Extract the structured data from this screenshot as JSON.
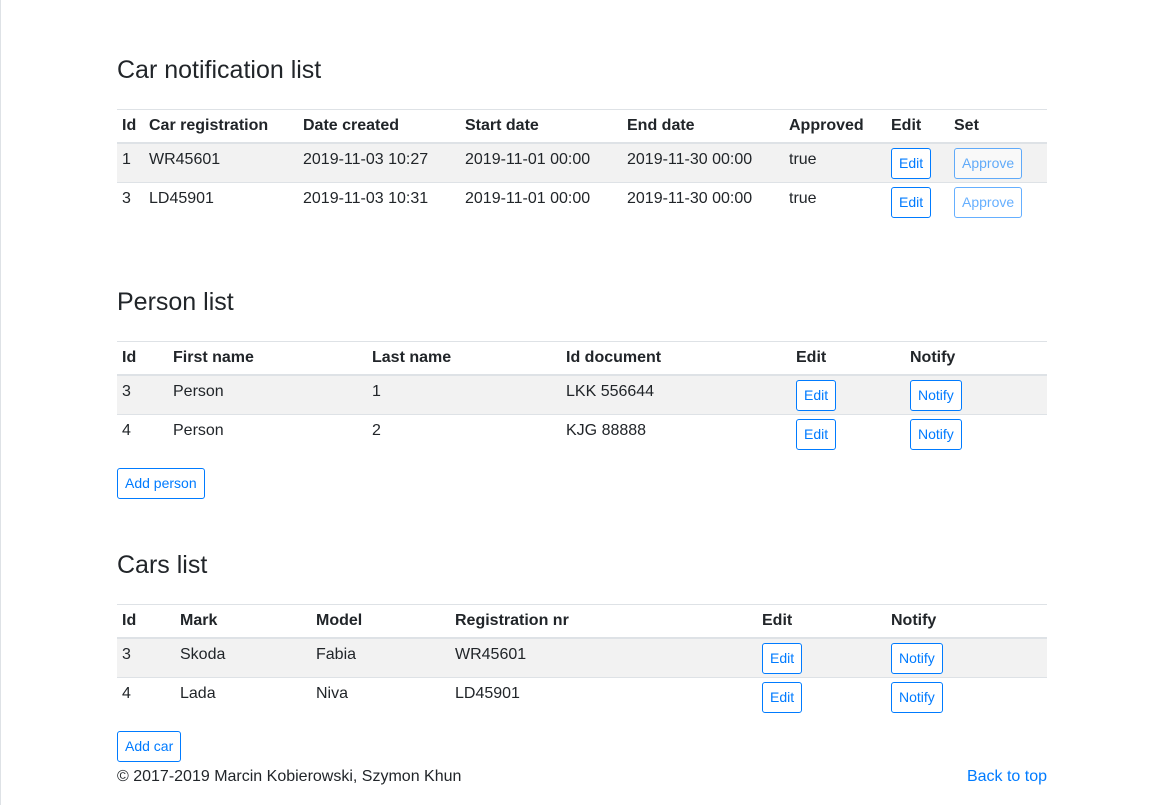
{
  "notifications": {
    "title": "Car notification list",
    "headers": [
      "Id",
      "Car registration",
      "Date created",
      "Start date",
      "End date",
      "Approved",
      "Edit",
      "Set"
    ],
    "rows": [
      {
        "id": "1",
        "reg": "WR45601",
        "created": "2019-11-03 10:27",
        "start": "2019-11-01 00:00",
        "end": "2019-11-30 00:00",
        "approved": "true",
        "edit": "Edit",
        "set": "Approve"
      },
      {
        "id": "3",
        "reg": "LD45901",
        "created": "2019-11-03 10:31",
        "start": "2019-11-01 00:00",
        "end": "2019-11-30 00:00",
        "approved": "true",
        "edit": "Edit",
        "set": "Approve"
      }
    ]
  },
  "persons": {
    "title": "Person list",
    "headers": [
      "Id",
      "First name",
      "Last name",
      "Id document",
      "Edit",
      "Notify"
    ],
    "rows": [
      {
        "id": "3",
        "first": "Person",
        "last": "1",
        "doc": "LKK 556644",
        "edit": "Edit",
        "notify": "Notify"
      },
      {
        "id": "4",
        "first": "Person",
        "last": "2",
        "doc": "KJG 88888",
        "edit": "Edit",
        "notify": "Notify"
      }
    ],
    "add_label": "Add person"
  },
  "cars": {
    "title": "Cars list",
    "headers": [
      "Id",
      "Mark",
      "Model",
      "Registration nr",
      "Edit",
      "Notify"
    ],
    "rows": [
      {
        "id": "3",
        "mark": "Skoda",
        "model": "Fabia",
        "reg": "WR45601",
        "edit": "Edit",
        "notify": "Notify"
      },
      {
        "id": "4",
        "mark": "Lada",
        "model": "Niva",
        "reg": "LD45901",
        "edit": "Edit",
        "notify": "Notify"
      }
    ],
    "add_label": "Add car"
  },
  "footer": {
    "copyright": "© 2017-2019 Marcin Kobierowski, Szymon Khun",
    "back_to_top": "Back to top"
  },
  "colors": {
    "accent": "#007bff",
    "stripe": "#f2f2f2",
    "border": "#dee2e6"
  }
}
